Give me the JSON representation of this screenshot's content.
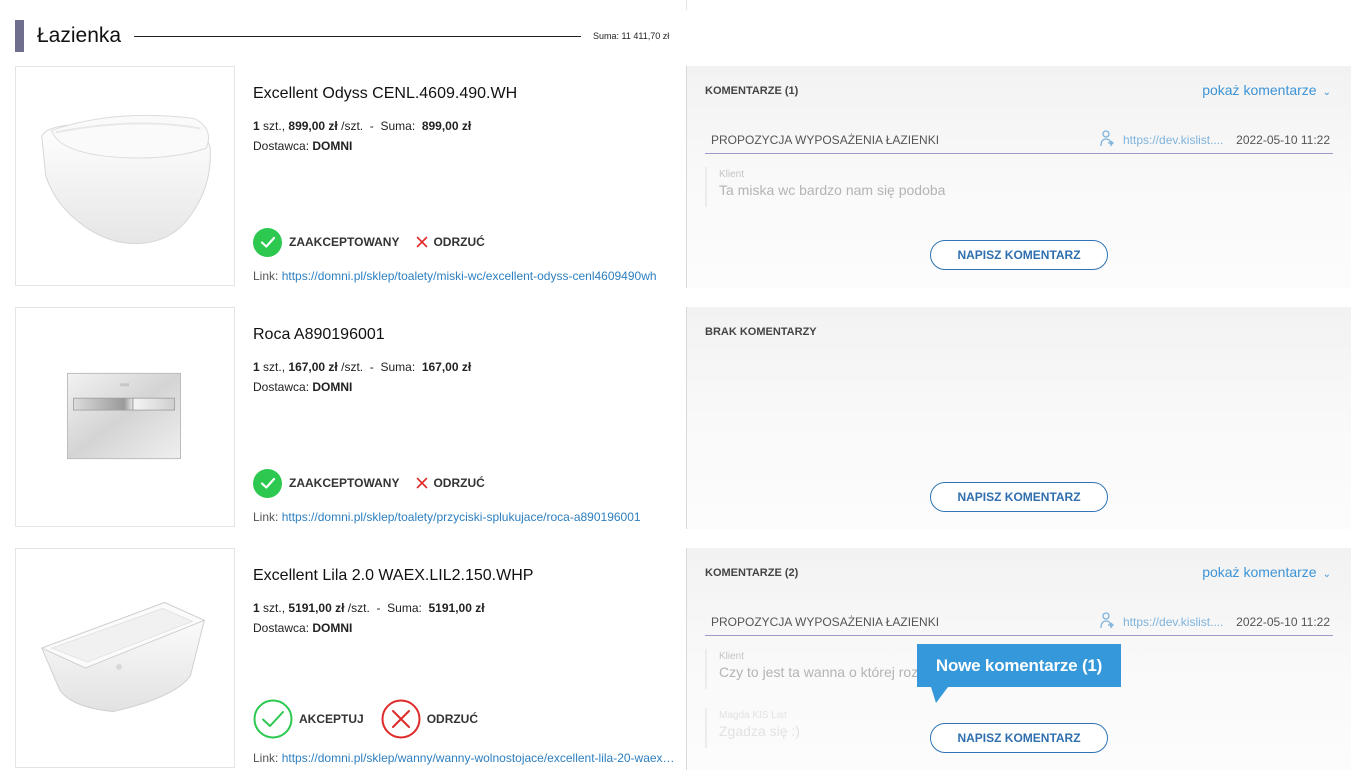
{
  "section": {
    "title": "Łazienka",
    "sum": "Suma: 11 411,70 zł"
  },
  "products": [
    {
      "name": "Excellent Odyss CENL.4609.490.WH",
      "qty": "1",
      "qty_unit": "szt.,",
      "unit_price": "899,00 zł",
      "per_unit": "/szt.",
      "sum_label": "Suma:",
      "sum": "899,00 zł",
      "supplier_label": "Dostawca:",
      "supplier": "DOMNI",
      "accept_label": "ZAAKCEPTOWANY",
      "reject_label": "ODRZUĆ",
      "link_label": "Link:",
      "link": "https://domni.pl/sklep/toalety/miski-wc/excellent-odyss-cenl4609490wh",
      "image_icon": "wall-hung-toilet"
    },
    {
      "name": "Roca A890196001",
      "qty": "1",
      "qty_unit": "szt.,",
      "unit_price": "167,00 zł",
      "per_unit": "/szt.",
      "sum_label": "Suma:",
      "sum": "167,00 zł",
      "supplier_label": "Dostawca:",
      "supplier": "DOMNI",
      "accept_label": "ZAAKCEPTOWANY",
      "reject_label": "ODRZUĆ",
      "link_label": "Link:",
      "link": "https://domni.pl/sklep/toalety/przyciski-splukujace/roca-a890196001",
      "image_icon": "flush-plate"
    },
    {
      "name": "Excellent Lila 2.0 WAEX.LIL2.150.WHP",
      "qty": "1",
      "qty_unit": "szt.,",
      "unit_price": "5191,00 zł",
      "per_unit": "/szt.",
      "sum_label": "Suma:",
      "sum": "5191,00 zł",
      "supplier_label": "Dostawca:",
      "supplier": "DOMNI",
      "accept_label": "AKCEPTUJ",
      "reject_label": "ODRZUĆ",
      "link_label": "Link:",
      "link": "https://domni.pl/sklep/wanny/wanny-wolnostojace/excellent-lila-20-waex…",
      "image_icon": "freestanding-bathtub"
    }
  ],
  "comments": [
    {
      "title": "KOMENTARZE (1)",
      "show_label": "pokaż komentarze",
      "thread_title": "PROPOZYCJA WYPOSAŻENIA ŁAZIENKI",
      "thread_url": "https://dev.kislist....",
      "thread_date": "2022-05-10 11:22",
      "messages": [
        {
          "author": "Klient",
          "text": "Ta miska wc bardzo nam się podoba"
        }
      ],
      "write_label": "NAPISZ KOMENTARZ"
    },
    {
      "title": "BRAK KOMENTARZY",
      "write_label": "NAPISZ KOMENTARZ"
    },
    {
      "title": "KOMENTARZE (2)",
      "show_label": "pokaż komentarze",
      "thread_title": "PROPOZYCJA WYPOSAŻENIA ŁAZIENKI",
      "thread_url": "https://dev.kislist....",
      "thread_date": "2022-05-10 11:22",
      "messages": [
        {
          "author": "Klient",
          "text": "Czy to jest ta wanna o której rozm"
        },
        {
          "author": "Magda KIS List",
          "text": "Zgadza się :)"
        }
      ],
      "write_label": "NAPISZ KOMENTARZ"
    }
  ],
  "tooltip": {
    "text": "Nowe komentarze (1)"
  },
  "colors": {
    "accent_blue": "#3498db",
    "accept_green": "#2cc84f",
    "reject_red": "#e02a2a",
    "section_bar": "#6f6f8d"
  }
}
